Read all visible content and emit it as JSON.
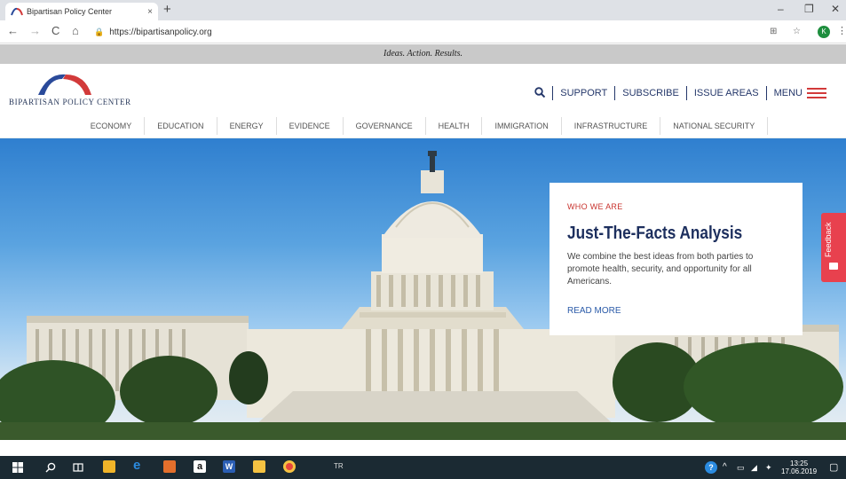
{
  "browser": {
    "tab_title": "Bipartisan Policy Center",
    "tab_close": "×",
    "new_tab": "+",
    "url": "https://bipartisanpolicy.org",
    "controls": {
      "minimize": "–",
      "maximize": "❐",
      "close": "✕"
    },
    "nav": {
      "back": "←",
      "forward": "→",
      "reload": "C",
      "home": "⌂"
    },
    "profile_initial": "K"
  },
  "site": {
    "tagline": "Ideas. Action. Results.",
    "logo_text": "BIPARTISAN POLICY CENTER",
    "top_nav": [
      "SUPPORT",
      "SUBSCRIBE",
      "ISSUE AREAS",
      "MENU"
    ],
    "categories": [
      "ECONOMY",
      "EDUCATION",
      "ENERGY",
      "EVIDENCE",
      "GOVERNANCE",
      "HEALTH",
      "IMMIGRATION",
      "INFRASTRUCTURE",
      "NATIONAL SECURITY"
    ],
    "card": {
      "eyebrow": "WHO WE ARE",
      "title": "Just-The-Facts Analysis",
      "body": "We combine the best ideas from both parties to promote health, security, and opportunity for all Americans.",
      "link": "READ MORE"
    },
    "feedback_label": "Feedback"
  },
  "taskbar": {
    "language": "TR",
    "time": "13:25",
    "date": "17.06.2019"
  },
  "colors": {
    "brand_navy": "#1d2f5e",
    "brand_red": "#c8332e",
    "feedback": "#e8414e"
  }
}
